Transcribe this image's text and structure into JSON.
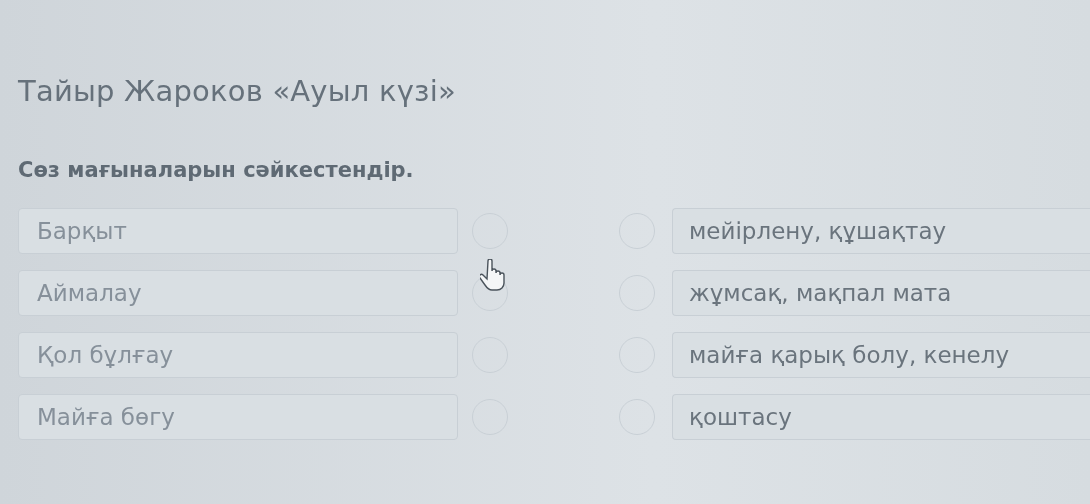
{
  "title": "Тайыр Жароков «Ауыл күзі»",
  "instruction": "Сөз мағыналарын сәйкестендір.",
  "left_items": [
    "Барқыт",
    "Аймалау",
    "Қол бұлғау",
    "Майға бөгу"
  ],
  "right_items": [
    "мейірлену, құшақтау",
    "жұмсақ, мақпал мата",
    "майға қарық болу, кенелу",
    "қоштасу"
  ]
}
